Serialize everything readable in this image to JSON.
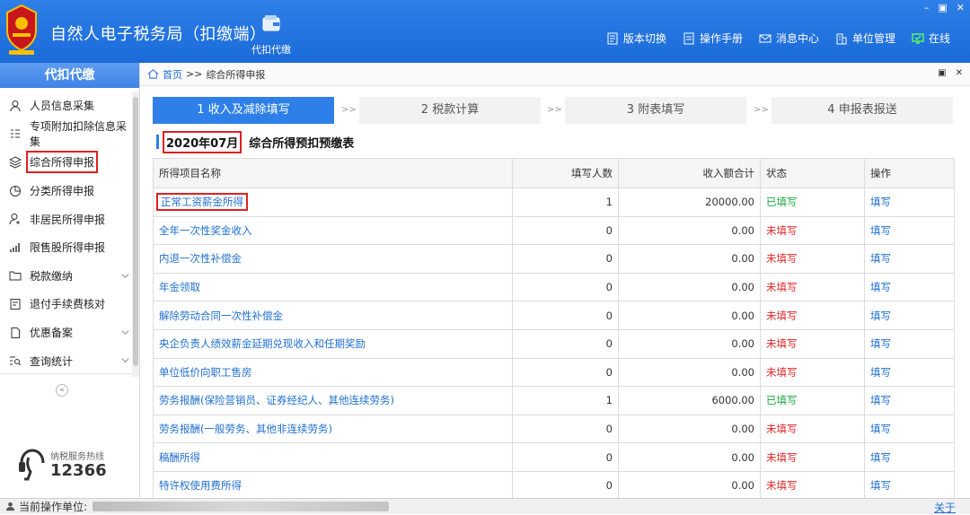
{
  "app": {
    "title": "自然人电子税务局（扣缴端）",
    "module_label": "代扣代缴"
  },
  "topbar": {
    "links": [
      {
        "label": "版本切换",
        "icon": "version-icon"
      },
      {
        "label": "操作手册",
        "icon": "manual-icon"
      },
      {
        "label": "消息中心",
        "icon": "mail-icon"
      },
      {
        "label": "单位管理",
        "icon": "building-icon"
      },
      {
        "label": "在线",
        "icon": "monitor-icon"
      }
    ],
    "window_controls": [
      "–",
      "▣",
      "✕"
    ]
  },
  "sidebar": {
    "header": "代扣代缴",
    "items": [
      {
        "label": "人员信息采集",
        "icon": "person-icon"
      },
      {
        "label": "专项附加扣除信息采集",
        "icon": "list-icon"
      },
      {
        "label": "综合所得申报",
        "icon": "layers-icon",
        "active": true
      },
      {
        "label": "分类所得申报",
        "icon": "pie-icon"
      },
      {
        "label": "非居民所得申报",
        "icon": "person-alt-icon"
      },
      {
        "label": "限售股所得申报",
        "icon": "bar-chart-icon"
      },
      {
        "label": "税款缴纳",
        "icon": "folder-icon",
        "expandable": true
      },
      {
        "label": "退付手续费核对",
        "icon": "doc-icon"
      },
      {
        "label": "优惠备案",
        "icon": "file-icon",
        "expandable": true
      },
      {
        "label": "查询统计",
        "icon": "search-list-icon",
        "expandable": true
      }
    ],
    "collapse_glyph": "«",
    "hotline": {
      "label": "纳税服务热线",
      "number": "12366"
    }
  },
  "breadcrumb": {
    "home": "首页",
    "separator": ">>",
    "current": "综合所得申报"
  },
  "steps": [
    {
      "label": "1 收入及减除填写",
      "active": true
    },
    {
      "label": "2 税款计算"
    },
    {
      "label": "3 附表填写"
    },
    {
      "label": "4 申报表报送"
    }
  ],
  "step_separator": ">>",
  "form": {
    "period": "2020年07月",
    "title": "综合所得预扣预缴表"
  },
  "table": {
    "headers": {
      "name": "所得项目名称",
      "count": "填写人数",
      "income": "收入额合计",
      "status": "状态",
      "action": "操作"
    },
    "rows": [
      {
        "name": "正常工资薪金所得",
        "count": "1",
        "income": "20000.00",
        "status": "已填写",
        "filled": true,
        "action": "填写"
      },
      {
        "name": "全年一次性奖金收入",
        "count": "0",
        "income": "0.00",
        "status": "未填写",
        "filled": false,
        "action": "填写"
      },
      {
        "name": "内退一次性补偿金",
        "count": "0",
        "income": "0.00",
        "status": "未填写",
        "filled": false,
        "action": "填写"
      },
      {
        "name": "年金领取",
        "count": "0",
        "income": "0.00",
        "status": "未填写",
        "filled": false,
        "action": "填写"
      },
      {
        "name": "解除劳动合同一次性补偿金",
        "count": "0",
        "income": "0.00",
        "status": "未填写",
        "filled": false,
        "action": "填写"
      },
      {
        "name": "央企负责人绩效薪金延期兑现收入和任期奖励",
        "count": "0",
        "income": "0.00",
        "status": "未填写",
        "filled": false,
        "action": "填写"
      },
      {
        "name": "单位低价向职工售房",
        "count": "0",
        "income": "0.00",
        "status": "未填写",
        "filled": false,
        "action": "填写"
      },
      {
        "name": "劳务报酬(保险营销员、证券经纪人、其他连续劳务)",
        "count": "1",
        "income": "6000.00",
        "status": "已填写",
        "filled": true,
        "action": "填写"
      },
      {
        "name": "劳务报酬(一般劳务、其他非连续劳务)",
        "count": "0",
        "income": "0.00",
        "status": "未填写",
        "filled": false,
        "action": "填写"
      },
      {
        "name": "稿酬所得",
        "count": "0",
        "income": "0.00",
        "status": "未填写",
        "filled": false,
        "action": "填写"
      },
      {
        "name": "特许权使用费所得",
        "count": "0",
        "income": "0.00",
        "status": "未填写",
        "filled": false,
        "action": "填写"
      }
    ]
  },
  "statusbar": {
    "label": "当前操作单位:",
    "about": "关于"
  },
  "colors": {
    "brand": "#1a6ad9",
    "filled": "#19a840",
    "unfilled": "#e02525",
    "highlight": "#e02020"
  }
}
